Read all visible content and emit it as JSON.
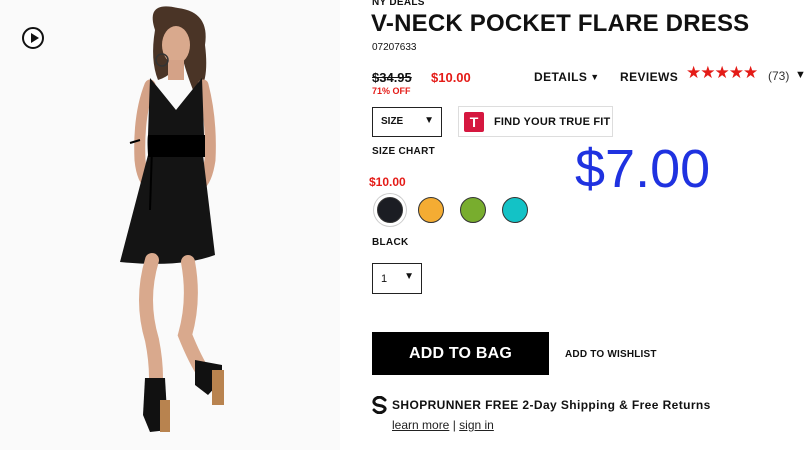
{
  "product": {
    "brand": "NY DEALS",
    "title": "V-NECK POCKET FLARE DRESS",
    "sku": "07207633",
    "old_price": "$34.95",
    "new_price": "$10.00",
    "percent_off": "71% OFF"
  },
  "tabs": {
    "details_label": "DETAILS",
    "reviews_label": "REVIEWS",
    "rating": 4.5,
    "stars": "★★★★★",
    "review_count": "(73)"
  },
  "size": {
    "selected_label": "SIZE",
    "fit_label": "FIND YOUR TRUE FIT",
    "fit_logo": "T",
    "chart_label": "SIZE CHART"
  },
  "overlay_price": "$7.00",
  "swatches": {
    "price": "$10.00",
    "colors": [
      {
        "name": "black",
        "hex": "#1b1d23"
      },
      {
        "name": "orange",
        "hex": "#f4ac33"
      },
      {
        "name": "green",
        "hex": "#78ad2e"
      },
      {
        "name": "teal",
        "hex": "#13c2c6"
      }
    ],
    "selected_name": "BLACK"
  },
  "quantity": {
    "value": "1"
  },
  "actions": {
    "add_to_bag": "ADD TO BAG",
    "wishlist": "ADD TO WISHLIST"
  },
  "shoprunner": {
    "text": "SHOPRUNNER FREE 2-Day Shipping & Free Returns",
    "learn_more": "learn more",
    "separator": "|",
    "sign_in": "sign in"
  },
  "icons": {
    "play": "play-icon",
    "chevron": "chevron-down-icon",
    "shoprunner": "shoprunner-logo-icon"
  }
}
